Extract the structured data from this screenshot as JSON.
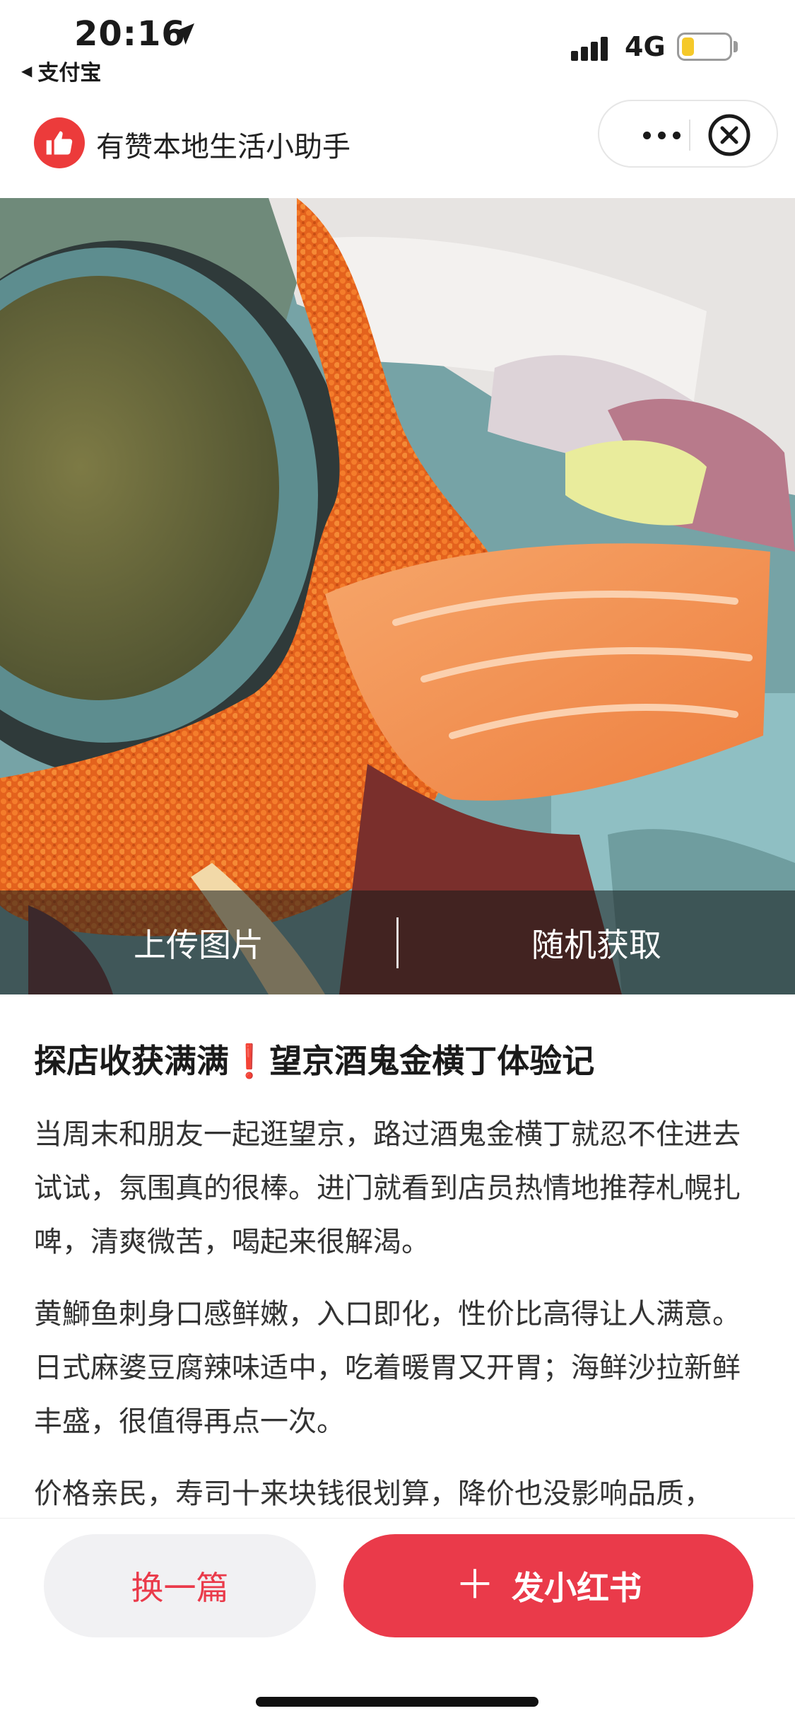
{
  "status_bar": {
    "time": "20:16",
    "back_app": "支付宝",
    "network": "4G",
    "battery_level": 0.25,
    "battery_color": "#f5c92a"
  },
  "navbar": {
    "app_name": "有赞本地生活小助手",
    "logo_icon": "thumbs-up-icon",
    "more_icon": "more-dots-icon",
    "close_icon": "close-circle-icon"
  },
  "hero": {
    "upload_label": "上传图片",
    "random_label": "随机获取"
  },
  "article": {
    "title": "探店收获满满❗️望京酒鬼金横丁体验记",
    "paragraphs": [
      "当周末和朋友一起逛望京，路过酒鬼金横丁就忍不住进去试试，氛围真的很棒。进门就看到店员热情地推荐札幌扎啤，清爽微苦，喝起来很解渴。",
      "黄鰤鱼刺身口感鲜嫩，入口即化，性价比高得让人满意。日式麻婆豆腐辣味适中，吃着暖胃又开胃；海鲜沙拉新鲜丰盛，很值得再点一次。",
      "价格亲民，寿司十来块钱很划算，降价也没影响品质，"
    ]
  },
  "bottom": {
    "switch_label": "换一篇",
    "post_label": "发小红书",
    "plus_icon": "plus-icon"
  },
  "colors": {
    "accent": "#ea3a4a",
    "logo": "#ec3b3b"
  }
}
